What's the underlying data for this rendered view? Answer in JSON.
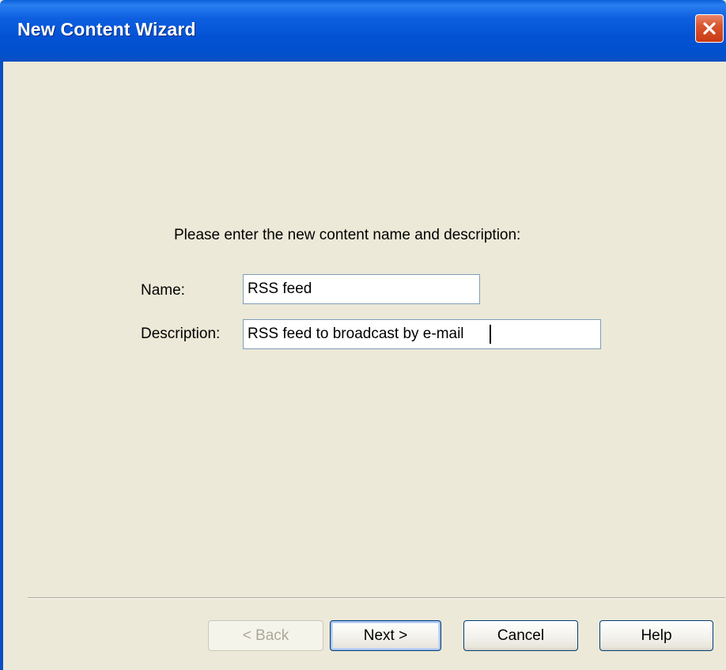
{
  "window": {
    "title": "New Content Wizard"
  },
  "form": {
    "prompt": "Please enter the new content name and description:",
    "name_label": "Name:",
    "name_value": "RSS feed",
    "description_label": "Description:",
    "description_value": "RSS feed to broadcast by e-mail"
  },
  "buttons": {
    "back": "< Back",
    "next": "Next >",
    "cancel": "Cancel",
    "help": "Help"
  },
  "icons": {
    "close": "close-icon"
  },
  "colors": {
    "titlebar": "#0352d4",
    "close_button": "#d9552e",
    "dialog_background": "#ece9d8",
    "disabled_text": "#aca899"
  }
}
